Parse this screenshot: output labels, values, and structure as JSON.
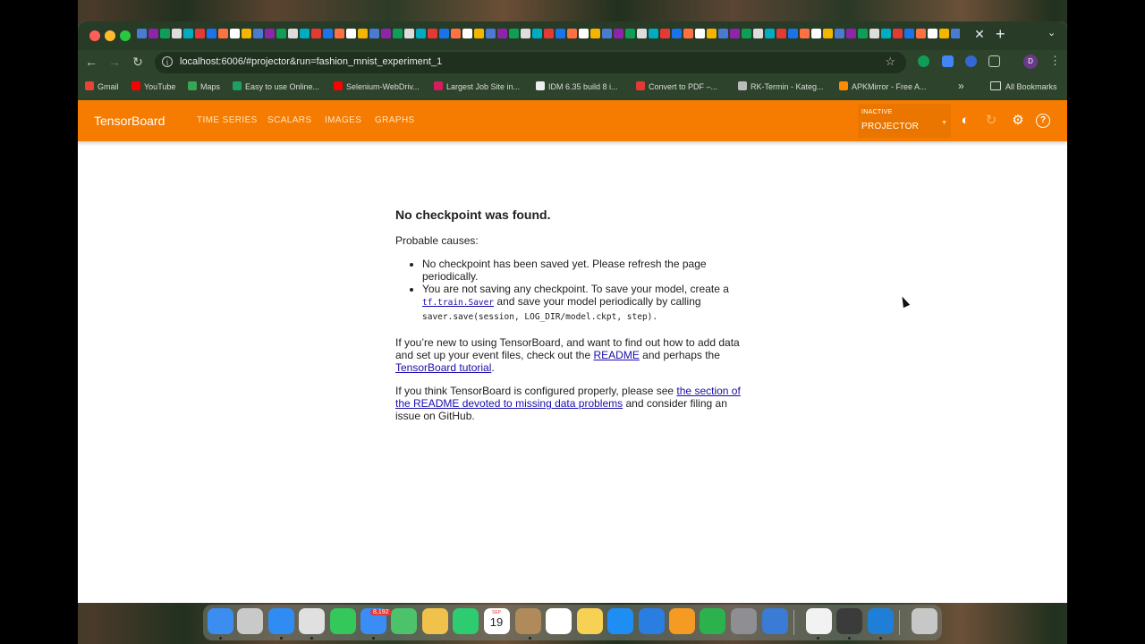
{
  "browser": {
    "url": "localhost:6006/#projector&run=fashion_mnist_experiment_1",
    "bookmarks": [
      {
        "label": "Gmail",
        "icon": "gmail-icon",
        "color": "#ea4335"
      },
      {
        "label": "YouTube",
        "icon": "youtube-icon",
        "color": "#ff0000"
      },
      {
        "label": "Maps",
        "icon": "maps-icon",
        "color": "#34a853"
      },
      {
        "label": "Easy to use Online...",
        "icon": "online-tool-icon",
        "color": "#1aa260"
      },
      {
        "label": "Selenium-WebDriv...",
        "icon": "youtube-icon",
        "color": "#ff0000"
      },
      {
        "label": "Largest Job Site in...",
        "icon": "job-site-icon",
        "color": "#d81b60"
      },
      {
        "label": "IDM 6.35 build 8 i...",
        "icon": "idm-icon",
        "color": "#eeeeee"
      },
      {
        "label": "Convert to PDF –...",
        "icon": "pdf-icon",
        "color": "#e53935"
      },
      {
        "label": "RK-Termin - Kateg...",
        "icon": "globe-icon",
        "color": "#bbbbbb"
      },
      {
        "label": "APKMirror - Free A...",
        "icon": "apkmirror-icon",
        "color": "#ff8a00"
      }
    ],
    "all_bookmarks_label": "All Bookmarks",
    "profile_initial": "D"
  },
  "tensorboard": {
    "brand": "TensorBoard",
    "tabs": [
      "TIME SERIES",
      "SCALARS",
      "IMAGES",
      "GRAPHS"
    ],
    "inactive_label": "INACTIVE",
    "inactive_value": "PROJECTOR"
  },
  "message": {
    "title": "No checkpoint was found.",
    "probable_causes": "Probable causes:",
    "cause1": "No checkpoint has been saved yet. Please refresh the page periodically.",
    "cause2_a": "You are not saving any checkpoint. To save your model, create a",
    "cause2_link": "tf.train.Saver",
    "cause2_b": "and save your model periodically by calling",
    "cause2_code": "saver.save(session, LOG_DIR/model.ckpt, step).",
    "para1_a": "If you’re new to using TensorBoard, and want to find out how to add data and set up your event files, check out the",
    "para1_link1": "README",
    "para1_b": "and perhaps the",
    "para1_link2": "TensorBoard tutorial",
    "para1_c": ".",
    "para2_a": "If you think TensorBoard is configured properly, please see",
    "para2_link": "the section of the README devoted to missing data problems",
    "para2_b": "and consider filing an issue on GitHub."
  },
  "dock": {
    "mail_badge": "8,192",
    "calendar_month": "SEP",
    "calendar_day": "19"
  }
}
